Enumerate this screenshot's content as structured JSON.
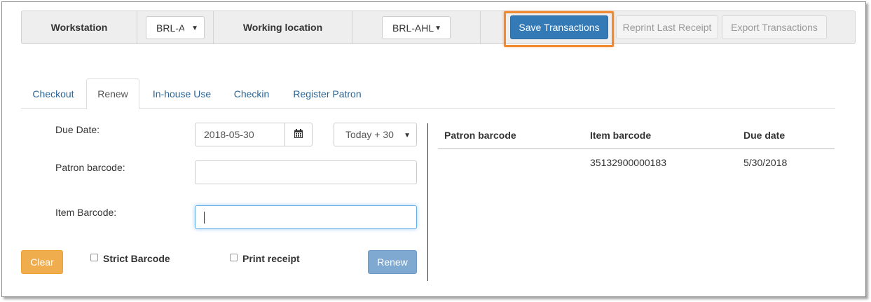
{
  "toolbar": {
    "workstation_label": "Workstation",
    "workstation_value": "BRL-A",
    "working_location_label": "Working location",
    "working_location_value": "BRL-AHL",
    "save_transactions": "Save Transactions",
    "reprint_last_receipt": "Reprint Last Receipt",
    "export_transactions": "Export Transactions"
  },
  "tabs": [
    "Checkout",
    "Renew",
    "In-house Use",
    "Checkin",
    "Register Patron"
  ],
  "active_tab": "Renew",
  "form": {
    "due_date_label": "Due Date:",
    "due_date_value": "2018-05-30",
    "due_date_preset": "Today + 30",
    "patron_barcode_label": "Patron barcode:",
    "patron_barcode_value": "",
    "item_barcode_label": "Item Barcode:",
    "item_barcode_value": "",
    "clear_label": "Clear",
    "strict_barcode_label": "Strict Barcode",
    "print_receipt_label": "Print receipt",
    "renew_label": "Renew"
  },
  "table": {
    "headers": [
      "Patron barcode",
      "Item barcode",
      "Due date"
    ],
    "rows": [
      [
        "",
        "35132900000183",
        "5/30/2018"
      ]
    ]
  },
  "icons": {
    "calendar": "calendar-icon",
    "select_caret": "caret-down-icon"
  },
  "colors": {
    "primary": "#337ab7",
    "warning": "#f0ad4e",
    "highlight": "#f0892f",
    "link": "#2a6496"
  }
}
